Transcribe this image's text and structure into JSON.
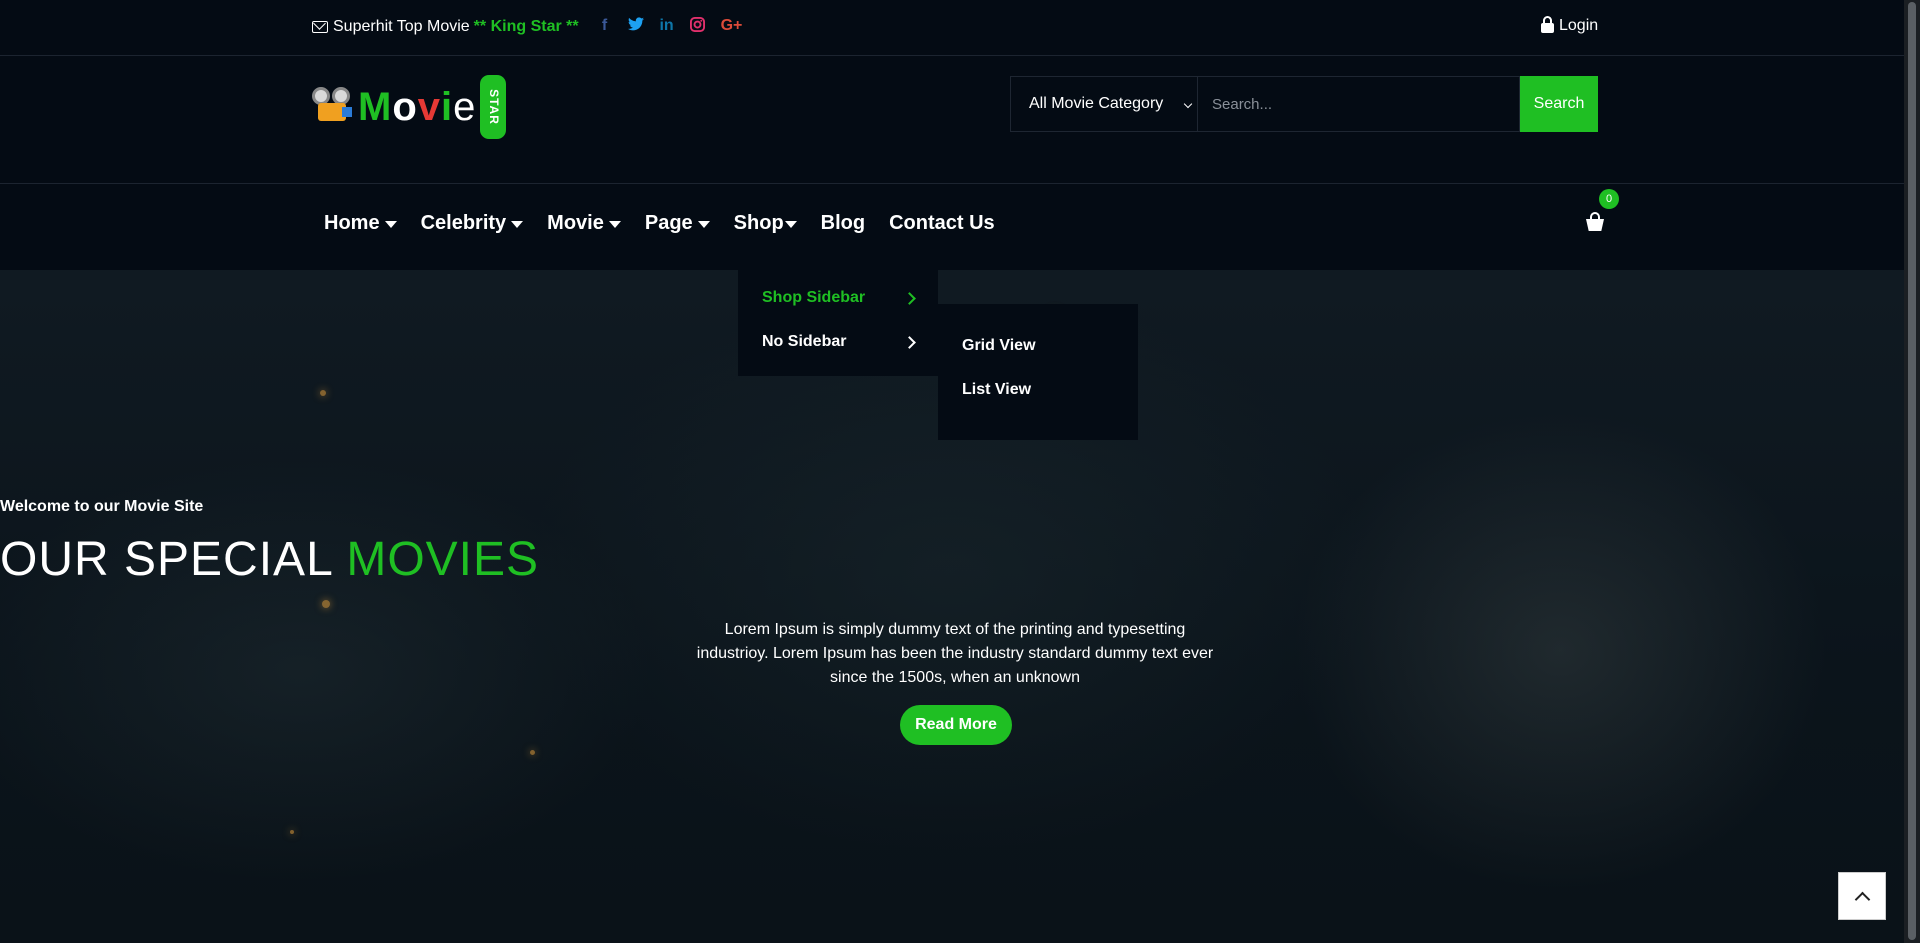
{
  "topbar": {
    "tagline_prefix": "Superhit Top Movie",
    "tagline_highlight": "** King Star **",
    "social_icons": [
      "facebook-icon",
      "twitter-icon",
      "linkedin-icon",
      "instagram-icon",
      "google-plus-icon"
    ],
    "login_label": "Login"
  },
  "logo": {
    "letters": [
      "M",
      "o",
      "v",
      "i",
      "e"
    ],
    "badge": "STAR"
  },
  "search": {
    "category_selected": "All Movie Category",
    "placeholder": "Search...",
    "button_label": "Search"
  },
  "nav": {
    "items": [
      {
        "label": "Home",
        "has_caret": true
      },
      {
        "label": "Celebrity",
        "has_caret": true
      },
      {
        "label": "Movie",
        "has_caret": true
      },
      {
        "label": "Page",
        "has_caret": true
      },
      {
        "label": "Shop",
        "has_caret": true
      },
      {
        "label": "Blog",
        "has_caret": false
      },
      {
        "label": "Contact Us",
        "has_caret": false
      }
    ],
    "cart_count": "0"
  },
  "shop_menu": {
    "items": [
      {
        "label": "Shop Sidebar"
      },
      {
        "label": "No Sidebar"
      }
    ],
    "submenu": [
      {
        "label": "Grid View"
      },
      {
        "label": "List View"
      }
    ]
  },
  "hero": {
    "welcome": "Welcome to our Movie Site",
    "title_white": "OUR SPECIAL",
    "title_green": "MOVIES",
    "description": "Lorem Ipsum is simply dummy text of the printing and typesetting industrioy. Lorem Ipsum has been the industry standard dummy text ever since the 1500s, when an unknown",
    "button_label": "Read More"
  },
  "colors": {
    "accent": "#1fbf23",
    "background": "#040b14"
  }
}
